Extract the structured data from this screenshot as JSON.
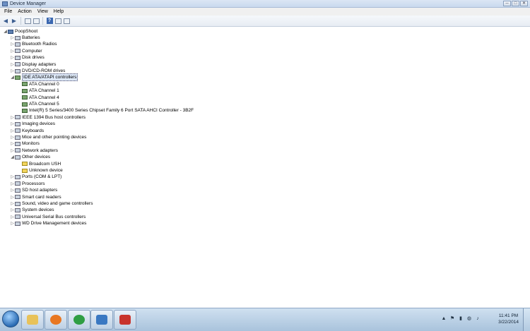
{
  "window": {
    "title": "Device Manager",
    "controls": [
      "─",
      "□",
      "✕"
    ]
  },
  "menu": [
    "File",
    "Action",
    "View",
    "Help"
  ],
  "toolbar": {
    "icons": [
      "back-arrow-icon",
      "forward-arrow-icon",
      "properties-icon",
      "scan-icon",
      "help-icon",
      "view-icon",
      "resources-icon"
    ],
    "help_glyph": "?"
  },
  "tree": {
    "root": "PoopShoot",
    "items": [
      {
        "label": "Batteries",
        "level": 1,
        "expander": "▷",
        "icon": "battery-icon"
      },
      {
        "label": "Bluetooth Radios",
        "level": 1,
        "expander": "▷",
        "icon": "bluetooth-icon"
      },
      {
        "label": "Computer",
        "level": 1,
        "expander": "▷",
        "icon": "computer-icon"
      },
      {
        "label": "Disk drives",
        "level": 1,
        "expander": "▷",
        "icon": "disk-icon"
      },
      {
        "label": "Display adapters",
        "level": 1,
        "expander": "▷",
        "icon": "display-icon"
      },
      {
        "label": "DVD/CD-ROM drives",
        "level": 1,
        "expander": "▷",
        "icon": "dvd-icon"
      },
      {
        "label": "IDE ATA/ATAPI controllers",
        "level": 1,
        "expander": "◢",
        "icon": "ide-icon",
        "selected": true
      },
      {
        "label": "ATA Channel 0",
        "level": 2,
        "expander": "",
        "icon": "ide-icon"
      },
      {
        "label": "ATA Channel 1",
        "level": 2,
        "expander": "",
        "icon": "ide-icon"
      },
      {
        "label": "ATA Channel 4",
        "level": 2,
        "expander": "",
        "icon": "ide-icon"
      },
      {
        "label": "ATA Channel 5",
        "level": 2,
        "expander": "",
        "icon": "ide-icon"
      },
      {
        "label": "Intel(R) 5 Series/3400 Series Chipset Family 6 Port SATA AHCI Controller - 3B2F",
        "level": 2,
        "expander": "",
        "icon": "ide-icon"
      },
      {
        "label": "IEEE 1394 Bus host controllers",
        "level": 1,
        "expander": "▷",
        "icon": "firewire-icon"
      },
      {
        "label": "Imaging devices",
        "level": 1,
        "expander": "▷",
        "icon": "camera-icon"
      },
      {
        "label": "Keyboards",
        "level": 1,
        "expander": "▷",
        "icon": "keyboard-icon"
      },
      {
        "label": "Mice and other pointing devices",
        "level": 1,
        "expander": "▷",
        "icon": "mouse-icon"
      },
      {
        "label": "Monitors",
        "level": 1,
        "expander": "▷",
        "icon": "monitor-icon"
      },
      {
        "label": "Network adapters",
        "level": 1,
        "expander": "▷",
        "icon": "network-icon"
      },
      {
        "label": "Other devices",
        "level": 1,
        "expander": "◢",
        "icon": "unknown-device-icon"
      },
      {
        "label": "Broadcom USH",
        "level": 2,
        "expander": "",
        "icon": "warning-device-icon"
      },
      {
        "label": "Unknown device",
        "level": 2,
        "expander": "",
        "icon": "warning-device-icon"
      },
      {
        "label": "Ports (COM & LPT)",
        "level": 1,
        "expander": "▷",
        "icon": "port-icon"
      },
      {
        "label": "Processors",
        "level": 1,
        "expander": "▷",
        "icon": "processor-icon"
      },
      {
        "label": "SD host adapters",
        "level": 1,
        "expander": "▷",
        "icon": "sd-card-icon"
      },
      {
        "label": "Smart card readers",
        "level": 1,
        "expander": "▷",
        "icon": "smart-card-icon"
      },
      {
        "label": "Sound, video and game controllers",
        "level": 1,
        "expander": "▷",
        "icon": "sound-icon"
      },
      {
        "label": "System devices",
        "level": 1,
        "expander": "▷",
        "icon": "system-icon"
      },
      {
        "label": "Universal Serial Bus controllers",
        "level": 1,
        "expander": "▷",
        "icon": "usb-icon"
      },
      {
        "label": "WD Drive Management devices",
        "level": 1,
        "expander": "▷",
        "icon": "wd-icon"
      }
    ]
  },
  "taskbar": {
    "apps": [
      {
        "name": "explorer-taskbar-button",
        "icon": "folder-icon",
        "color": "#e8c25a"
      },
      {
        "name": "media-player-taskbar-button",
        "icon": "play-icon",
        "color": "#e87722"
      },
      {
        "name": "chrome-taskbar-button",
        "icon": "chrome-icon",
        "color": "#2f9e44"
      },
      {
        "name": "network-taskbar-button",
        "icon": "computer-icon",
        "color": "#3a78c2"
      },
      {
        "name": "toolbox-taskbar-button",
        "icon": "toolbox-icon",
        "color": "#c8332c"
      }
    ],
    "clock": {
      "time": "11:41 PM",
      "date": "3/22/2014"
    },
    "tray": [
      "▲",
      "⚑",
      "▮",
      "◍",
      "♪"
    ]
  }
}
